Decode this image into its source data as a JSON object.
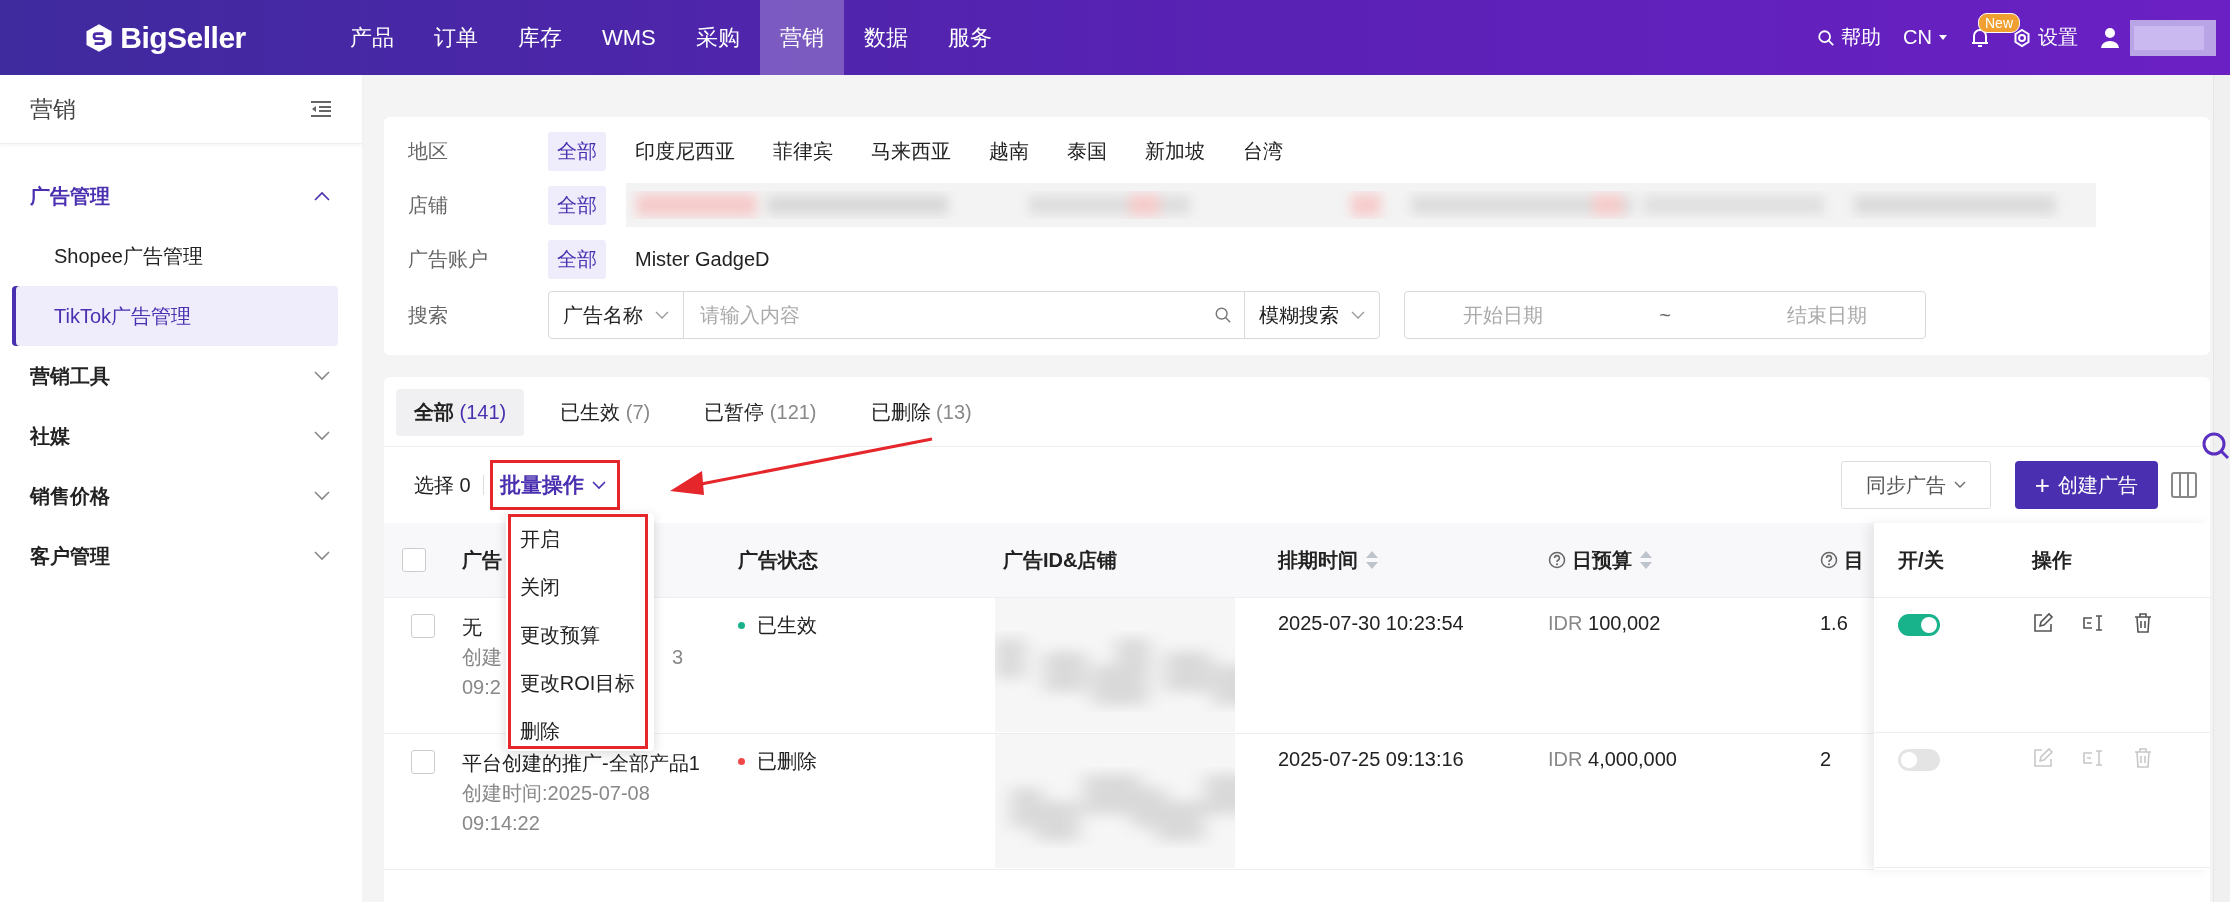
{
  "brand": {
    "name": "BigSeller"
  },
  "nav": [
    {
      "label": "产品",
      "selected": false
    },
    {
      "label": "订单",
      "selected": false
    },
    {
      "label": "库存",
      "selected": false
    },
    {
      "label": "WMS",
      "selected": false
    },
    {
      "label": "采购",
      "selected": false
    },
    {
      "label": "营销",
      "selected": true
    },
    {
      "label": "数据",
      "selected": false
    },
    {
      "label": "服务",
      "selected": false
    }
  ],
  "header_tools": {
    "help": "帮助",
    "language": "CN",
    "badge": "New",
    "settings": "设置"
  },
  "sidebar": {
    "title": "营销",
    "items": [
      {
        "label": "广告管理",
        "expanded": true,
        "children": [
          {
            "label": "Shopee广告管理",
            "selected": false
          },
          {
            "label": "TikTok广告管理",
            "selected": true
          }
        ]
      },
      {
        "label": "营销工具",
        "expanded": false
      },
      {
        "label": "社媒",
        "expanded": false
      },
      {
        "label": "销售价格",
        "expanded": false
      },
      {
        "label": "客户管理",
        "expanded": false
      }
    ]
  },
  "filters": {
    "rows": [
      {
        "label": "地区",
        "options": [
          {
            "label": "全部",
            "selected": true
          },
          {
            "label": "印度尼西亚",
            "selected": false
          },
          {
            "label": "菲律宾",
            "selected": false
          },
          {
            "label": "马来西亚",
            "selected": false
          },
          {
            "label": "越南",
            "selected": false
          },
          {
            "label": "泰国",
            "selected": false
          },
          {
            "label": "新加坡",
            "selected": false
          },
          {
            "label": "台湾",
            "selected": false
          }
        ]
      },
      {
        "label": "店铺",
        "options": [
          {
            "label": "全部",
            "selected": true
          }
        ],
        "kind": "picture"
      },
      {
        "label": "广告账户",
        "options": [
          {
            "label": "全部",
            "selected": true
          },
          {
            "label": "Mister GadgeD",
            "selected": false
          }
        ]
      }
    ],
    "search": {
      "label": "搜索",
      "field": "广告名称",
      "placeholder": "请输入内容",
      "mode": "模糊搜索",
      "start_placeholder": "开始日期",
      "separator": "~",
      "end_placeholder": "结束日期"
    }
  },
  "status_tabs": [
    {
      "label": "全部",
      "count": "(141)",
      "selected": true
    },
    {
      "label": "已生效",
      "count": "(7)",
      "selected": false
    },
    {
      "label": "已暂停",
      "count": "(121)",
      "selected": false
    },
    {
      "label": "已删除",
      "count": "(13)",
      "selected": false
    }
  ],
  "toolbar": {
    "selection": "选择 0",
    "batch": "批量操作",
    "sync": "同步广告",
    "create_icon": "+",
    "create": "创建广告"
  },
  "batch_menu": [
    "开启",
    "关闭",
    "更改预算",
    "更改ROI目标",
    "删除"
  ],
  "table": {
    "select_all_checked": false,
    "columns": [
      {
        "label": "广告",
        "help": false,
        "sortable": false
      },
      {
        "label": "广告状态",
        "help": false,
        "sortable": false
      },
      {
        "label": "广告ID&店铺",
        "help": false,
        "sortable": false
      },
      {
        "label": "排期时间",
        "help": false,
        "sortable": true
      },
      {
        "label": "日预算",
        "help": true,
        "sortable": true
      },
      {
        "label": "目",
        "help": true,
        "sortable": false
      }
    ],
    "sticky_columns": [
      "开/关",
      "操作"
    ],
    "rows": [
      {
        "name": "无",
        "created": [
          [
            "创建",
            "3"
          ],
          [
            "09:2"
          ]
        ],
        "status": "已生效",
        "color": "#19b38b",
        "schedule": "2025-07-30 10:23:54",
        "currency": "IDR",
        "budget": "100,002",
        "target": "1.6",
        "checked": false,
        "on": true,
        "disabled": false
      },
      {
        "name": "平台创建的推广-全部产品1",
        "created": [
          [
            "创建时间:2025-07-08"
          ],
          [
            "09:14:22"
          ]
        ],
        "status": "已删除",
        "color": "#f04848",
        "schedule": "2025-07-25 09:13:16",
        "currency": "IDR",
        "budget": "4,000,000",
        "target": "2",
        "checked": false,
        "on": false,
        "disabled": true
      }
    ]
  }
}
